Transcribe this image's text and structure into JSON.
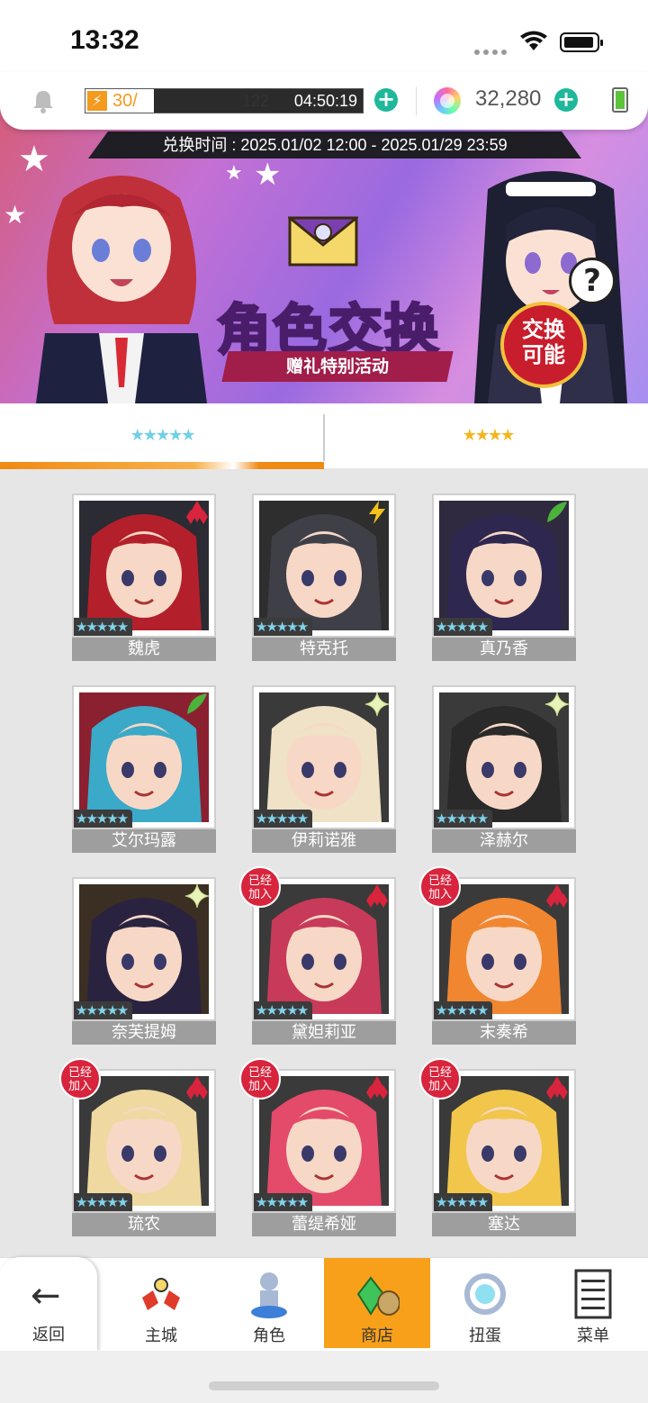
{
  "status_bar": {
    "time": "13:32"
  },
  "resources": {
    "stamina": "30/",
    "stamina_max": "122",
    "stamina_fraction": 0.246,
    "timer": "04:50:19",
    "gems": "32,280"
  },
  "banner": {
    "period": "兑换时间 : 2025.01/02 12:00 - 2025.01/29 23:59",
    "title": "角色交换",
    "subtitle": "赠礼特别活动",
    "badge": "交换\n可能",
    "help": "?"
  },
  "tabs": [
    {
      "label": "★★★★★",
      "active": true
    },
    {
      "label": "★★★★",
      "active": false
    }
  ],
  "joined_label": "已经\n加入",
  "cards": [
    {
      "name": "魏虎",
      "element": "diamond",
      "stars": "★★★★★",
      "joined": false,
      "bg": "#2b2b33",
      "hair": "#b3202b"
    },
    {
      "name": "特克托",
      "element": "lightning",
      "stars": "★★★★★",
      "joined": false,
      "bg": "#2e2e2e",
      "hair": "#3f3f48"
    },
    {
      "name": "真乃香",
      "element": "leaf",
      "stars": "★★★★★",
      "joined": false,
      "bg": "#2f2a3f",
      "hair": "#2e2750"
    },
    {
      "name": "艾尔玛露",
      "element": "leaf",
      "stars": "★★★★★",
      "joined": false,
      "bg": "#8a2030",
      "hair": "#3ba9c8"
    },
    {
      "name": "伊莉诺雅",
      "element": "sparkle",
      "stars": "★★★★★",
      "joined": false,
      "bg": "#3a3a3a",
      "hair": "#efe2c6"
    },
    {
      "name": "泽赫尔",
      "element": "sparkle",
      "stars": "★★★★★",
      "joined": false,
      "bg": "#3a3a3a",
      "hair": "#2a2a2a"
    },
    {
      "name": "奈芙提姆",
      "element": "sparkle",
      "stars": "★★★★★",
      "joined": false,
      "bg": "#3a2f22",
      "hair": "#2a2340"
    },
    {
      "name": "黛妲莉亚",
      "element": "diamond",
      "stars": "★★★★★",
      "joined": true,
      "bg": "#3a3a3a",
      "hair": "#c83a5a"
    },
    {
      "name": "末奏希",
      "element": "diamond",
      "stars": "★★★★★",
      "joined": true,
      "bg": "#3a3a3a",
      "hair": "#f08630"
    },
    {
      "name": "琉农",
      "element": "diamond",
      "stars": "★★★★★",
      "joined": true,
      "bg": "#3a3a3a",
      "hair": "#efd9a0"
    },
    {
      "name": "蕾缇希娅",
      "element": "diamond",
      "stars": "★★★★★",
      "joined": true,
      "bg": "#3a3a3a",
      "hair": "#e44a6a"
    },
    {
      "name": "塞达",
      "element": "diamond",
      "stars": "★★★★★",
      "joined": true,
      "bg": "#3a3a3a",
      "hair": "#f1c64a"
    }
  ],
  "nav": {
    "back": "返回",
    "items": [
      {
        "label": "主城",
        "icon": "castle-icon",
        "active": false
      },
      {
        "label": "角色",
        "icon": "character-icon",
        "active": false
      },
      {
        "label": "商店",
        "icon": "shop-icon",
        "active": true
      },
      {
        "label": "扭蛋",
        "icon": "gacha-icon",
        "active": false
      },
      {
        "label": "菜单",
        "icon": "menu-icon",
        "active": false
      }
    ]
  },
  "colors": {
    "accent": "#f08a12",
    "plus": "#1fb89a",
    "joined": "#d8243c",
    "element_diamond": "#d8243c",
    "element_leaf": "#4bb33a",
    "element_lightning": "#f5c21d"
  }
}
